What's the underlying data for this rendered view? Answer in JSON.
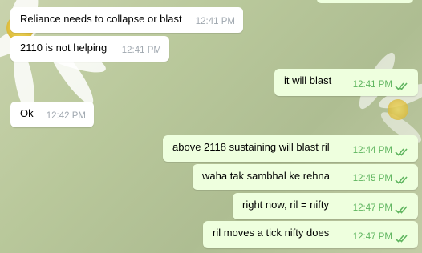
{
  "messages": [
    {
      "dir": "in",
      "text": "Reliance needs to collapse or blast",
      "time": "12:41 PM"
    },
    {
      "dir": "in",
      "text": "2110 is not helping",
      "time": "12:41 PM"
    },
    {
      "dir": "out",
      "text": "it will blast",
      "time": "12:41 PM",
      "status": "double-check-icon"
    },
    {
      "dir": "in",
      "text": "Ok",
      "time": "12:42 PM"
    },
    {
      "dir": "out",
      "text": "above 2118 sustaining will blast ril",
      "time": "12:44 PM",
      "status": "double-check-icon"
    },
    {
      "dir": "out",
      "text": "waha tak sambhal ke rehna",
      "time": "12:45 PM",
      "status": "double-check-icon"
    },
    {
      "dir": "out",
      "text": "right now, ril = nifty",
      "time": "12:47 PM",
      "status": "double-check-icon"
    },
    {
      "dir": "out",
      "text": "ril moves a tick nifty does",
      "time": "12:47 PM",
      "status": "double-check-icon"
    }
  ],
  "colors": {
    "incoming_bubble": "#ffffff",
    "outgoing_bubble": "#eeffde",
    "outgoing_time": "#5fb55f"
  }
}
